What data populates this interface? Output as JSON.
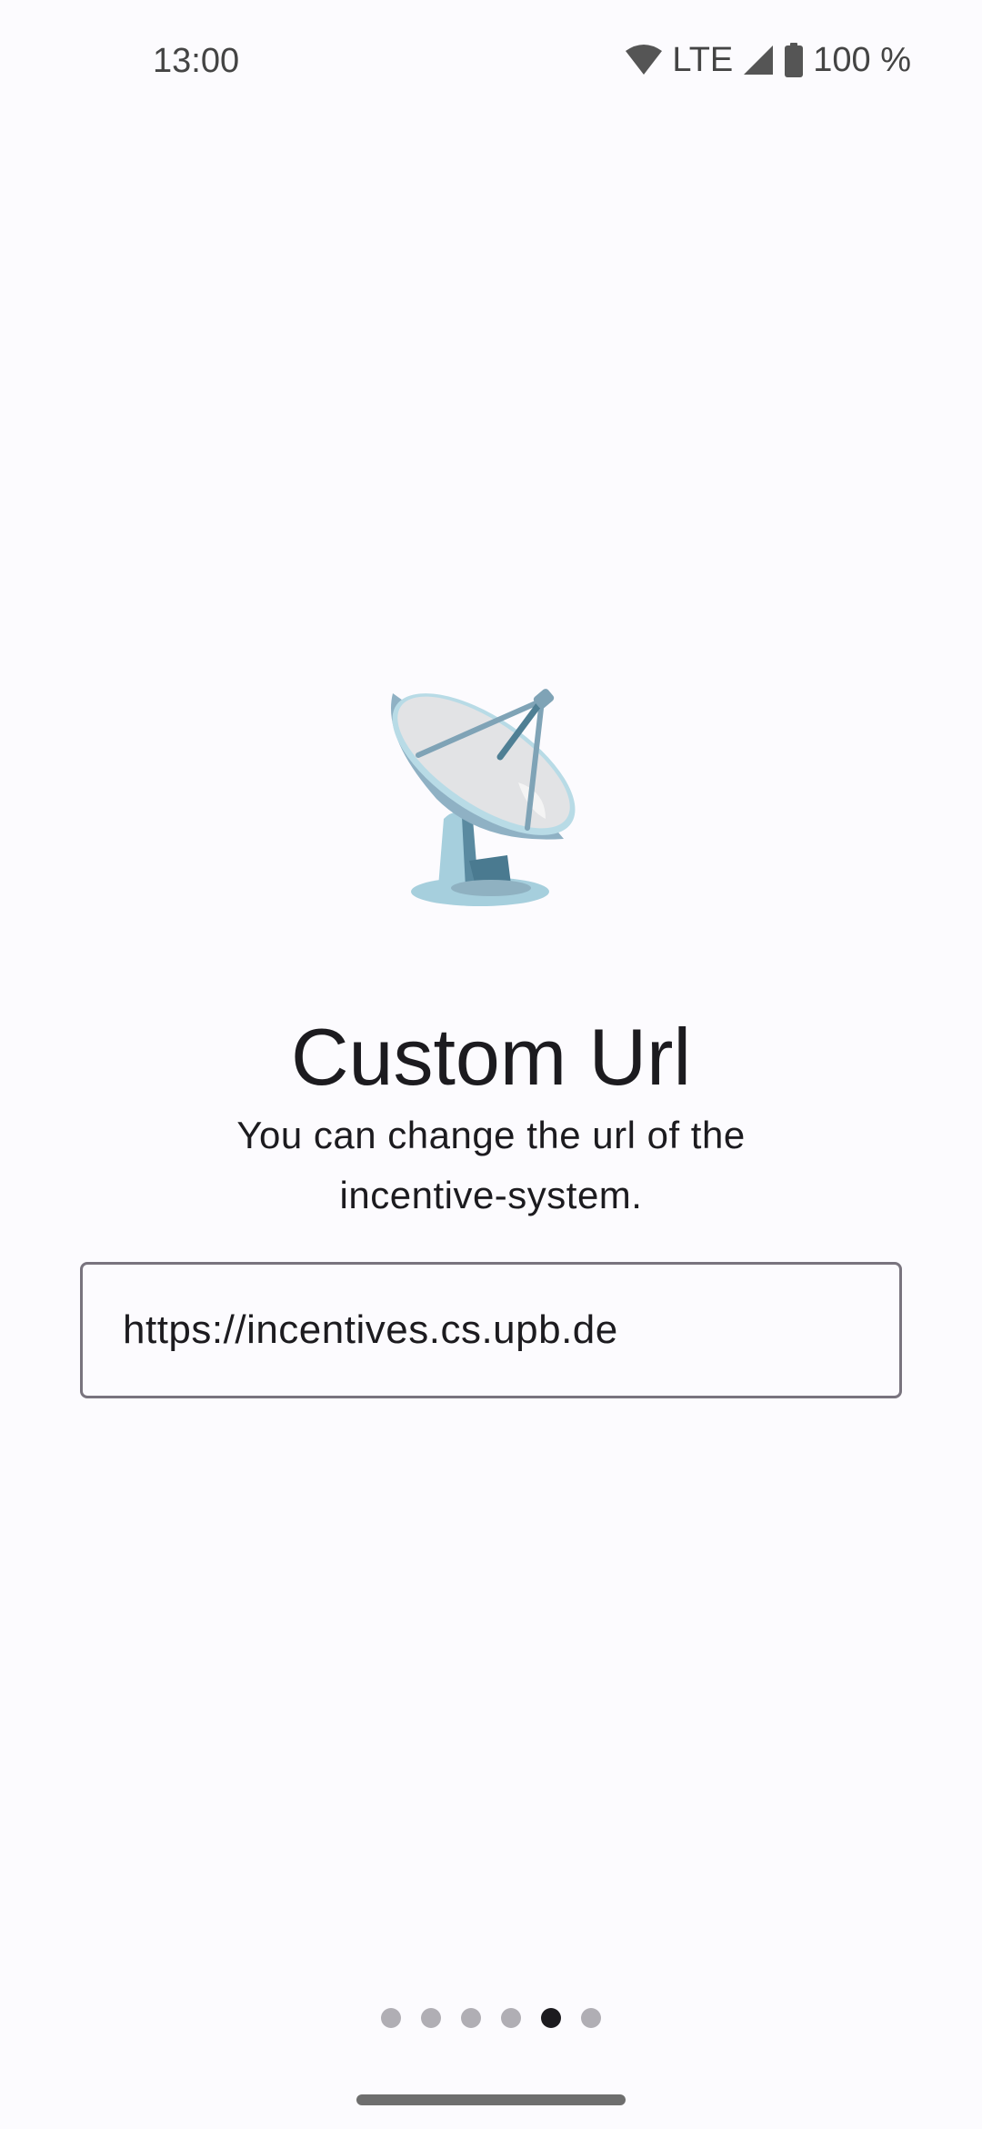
{
  "status_bar": {
    "time": "13:00",
    "network": "LTE",
    "battery": "100 %",
    "icons": [
      "wifi-icon",
      "signal-icon",
      "battery-icon"
    ]
  },
  "illustration": {
    "icon": "satellite-antenna-icon"
  },
  "onboarding": {
    "title": "Custom Url",
    "subtitle": "You can change the url of the incentive-system.",
    "url_value": "https://incentives.cs.upb.de"
  },
  "pager": {
    "total_pages": 6,
    "current_page": 5
  },
  "colors": {
    "background": "#fcfbfe",
    "text": "#1c1b1f",
    "outline": "#79747e",
    "dot_inactive": "#b0aeb4",
    "dot_active": "#1c1b1f"
  }
}
